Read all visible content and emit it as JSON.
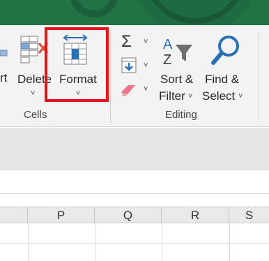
{
  "ribbon": {
    "insert_partial": "rt",
    "delete_label": "Delete",
    "format_label": "Format",
    "autosum_icon": "sigma-icon",
    "fill_icon": "fill-down-icon",
    "clear_icon": "eraser-icon",
    "sort_filter_line1": "Sort &",
    "sort_filter_line2": "Filter",
    "find_select_line1": "Find &",
    "find_select_line2": "Select",
    "dropdown_glyph": "˅"
  },
  "groups": {
    "cells": "Cells",
    "editing": "Editing"
  },
  "columns": [
    "P",
    "Q",
    "R",
    "S"
  ],
  "colors": {
    "title_bar": "#217346",
    "highlight": "#e3151b",
    "icon_blue": "#2b6fb4",
    "icon_red": "#e04e39"
  }
}
